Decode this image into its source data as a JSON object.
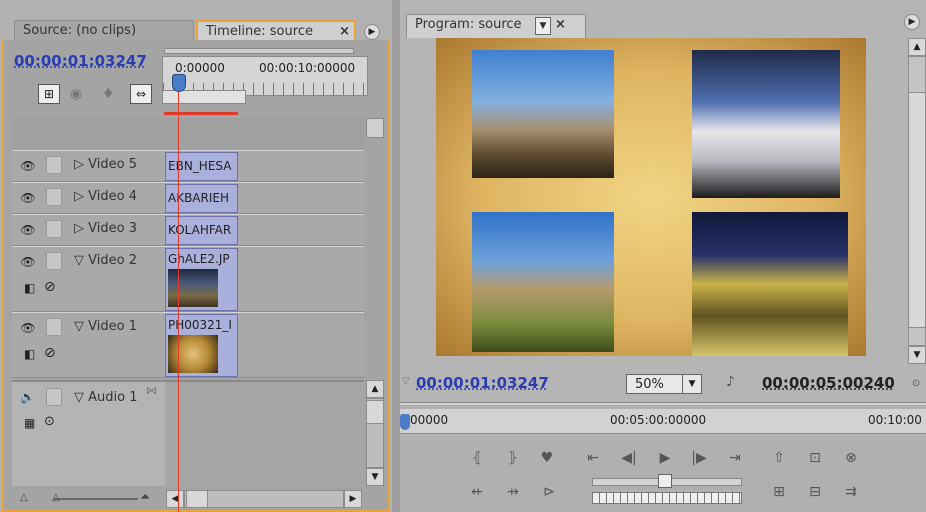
{
  "left_panel": {
    "tab_source": "Source: (no clips)",
    "tab_timeline": "Timeline: source",
    "tab_close": "×",
    "timecode": "00:00:01:03247",
    "ruler_start": "0:00000",
    "ruler_end": "00:00:10:00000",
    "tracks": [
      {
        "label": "Video 5",
        "clip": "EBN_HESA",
        "expanded": false
      },
      {
        "label": "Video 4",
        "clip": "AKBARIEH",
        "expanded": false
      },
      {
        "label": "Video 3",
        "clip": "KOLAHFAR",
        "expanded": false
      },
      {
        "label": "Video 2",
        "clip": "GhALE2.JP",
        "expanded": true
      },
      {
        "label": "Video 1",
        "clip": "PH00321_I",
        "expanded": true
      }
    ],
    "audio_track": {
      "label": "Audio 1"
    }
  },
  "right_panel": {
    "tab_program": "Program: source",
    "tab_close": "×",
    "current_timecode": "00:00:01:03247",
    "zoom": "50%",
    "duration": "00:00:05:00240",
    "ruler_start": "00000",
    "ruler_mid": "00:05:00:00000",
    "ruler_end": "00:10:00"
  },
  "colors": {
    "accent_orange": "#e8a33a",
    "timecode_blue": "#2a3db0",
    "clip_purple": "#aab0dc",
    "playhead_red": "#e03a2a"
  }
}
